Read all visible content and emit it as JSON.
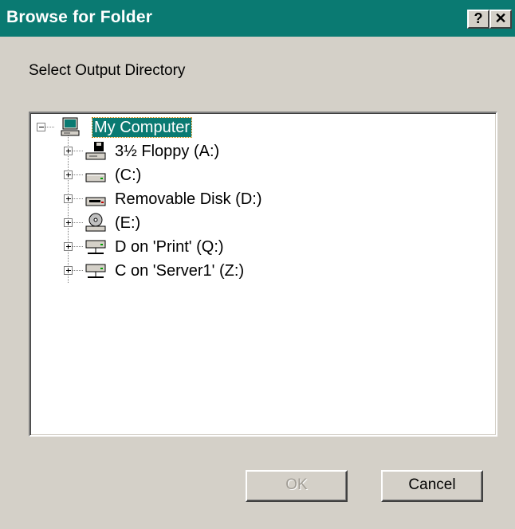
{
  "window": {
    "title": "Browse for Folder",
    "help_label": "?",
    "close_label": "✕"
  },
  "instruction": "Select Output Directory",
  "tree": {
    "root": {
      "label": "My Computer",
      "icon": "computer-icon",
      "expanded": true,
      "selected": true
    },
    "items": [
      {
        "label": "3½ Floppy (A:)",
        "icon": "floppy-drive-icon"
      },
      {
        "label": "(C:)",
        "icon": "hard-drive-icon"
      },
      {
        "label": "Removable Disk (D:)",
        "icon": "removable-disk-icon"
      },
      {
        "label": "(E:)",
        "icon": "cd-drive-icon"
      },
      {
        "label": "D on 'Print' (Q:)",
        "icon": "network-drive-icon"
      },
      {
        "label": "C on 'Server1' (Z:)",
        "icon": "network-drive-icon"
      }
    ]
  },
  "buttons": {
    "ok_label": "OK",
    "ok_enabled": false,
    "cancel_label": "Cancel"
  },
  "colors": {
    "title_bar": "#0a7a72",
    "dialog_face": "#d4d0c8",
    "selection": "#0a7a72"
  }
}
